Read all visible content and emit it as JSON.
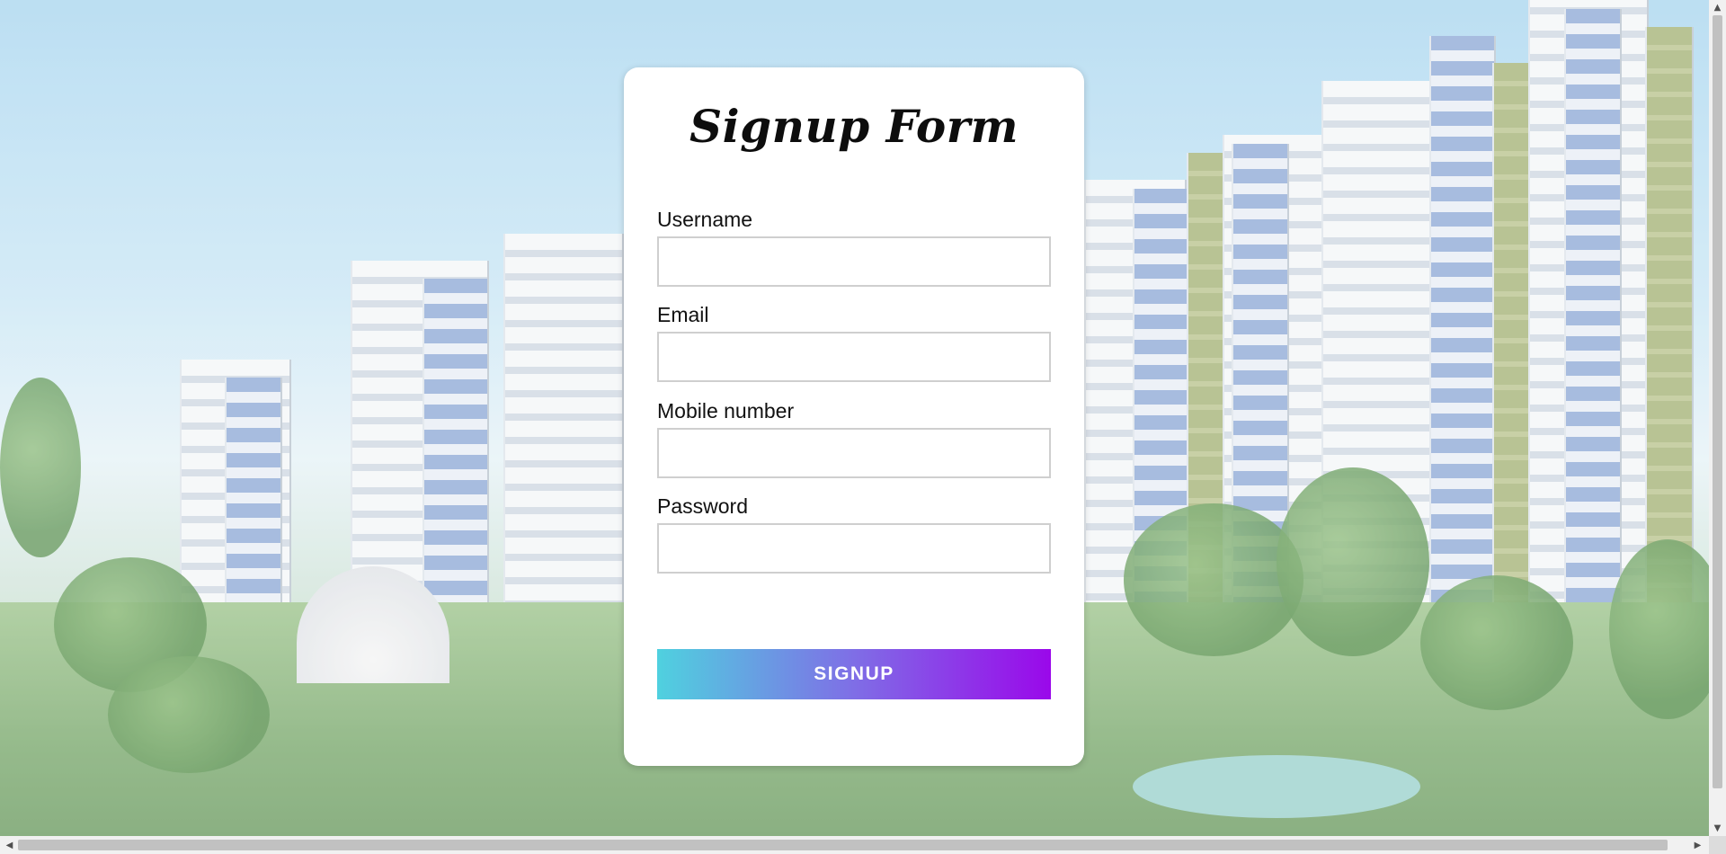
{
  "form": {
    "title": "Signup Form",
    "fields": [
      {
        "label": "Username",
        "value": "",
        "placeholder": ""
      },
      {
        "label": "Email",
        "value": "",
        "placeholder": ""
      },
      {
        "label": "Mobile number",
        "value": "",
        "placeholder": ""
      },
      {
        "label": "Password",
        "value": "",
        "placeholder": ""
      }
    ],
    "submit_label": "SIGNUP"
  },
  "scrollbars": {
    "up_arrow": "▲",
    "down_arrow": "▼",
    "left_arrow": "◀",
    "right_arrow": "▶"
  },
  "colors": {
    "button_gradient_start": "#4fd1df",
    "button_gradient_end": "#9a08ea",
    "card_background": "#ffffff"
  }
}
